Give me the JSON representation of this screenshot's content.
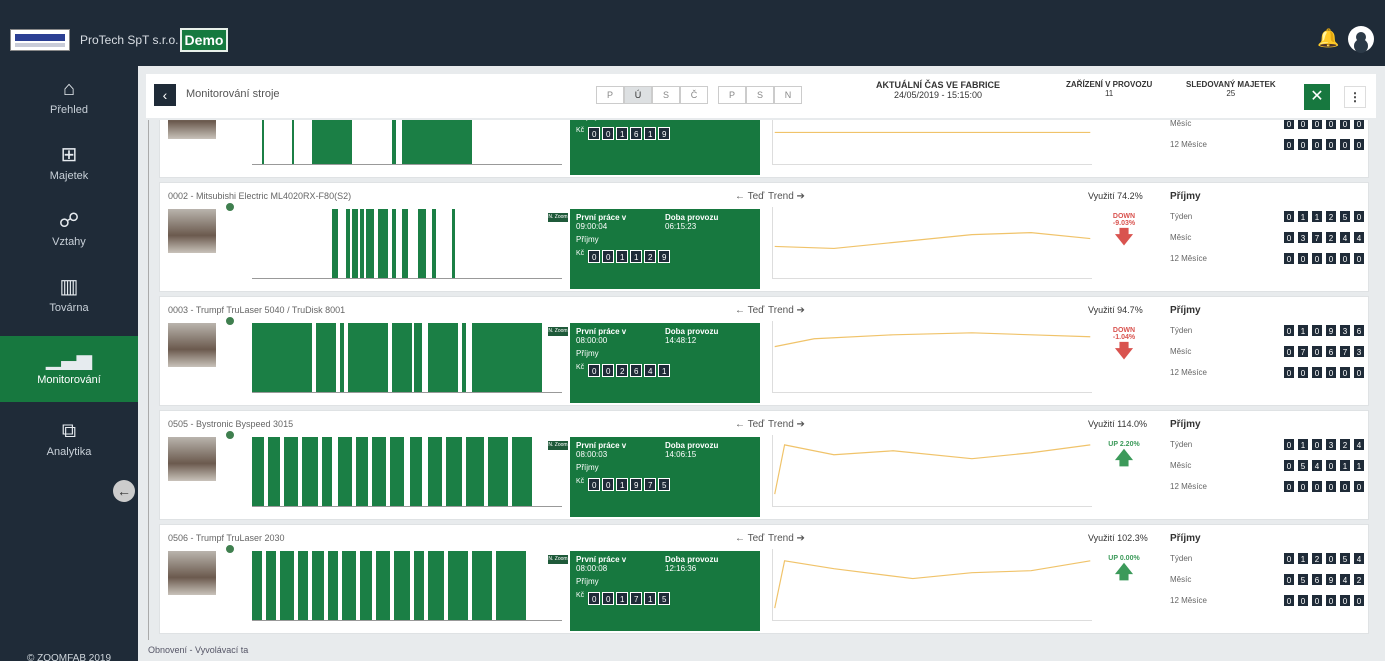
{
  "topbar": {
    "company": "ProTech SpT s.r.o.",
    "demo_label": "Demo"
  },
  "sidebar": {
    "items": [
      {
        "label": "Přehled",
        "icon": "home-icon"
      },
      {
        "label": "Majetek",
        "icon": "sitemap-icon"
      },
      {
        "label": "Vztahy",
        "icon": "users-icon"
      },
      {
        "label": "Továrna",
        "icon": "factory-icon"
      },
      {
        "label": "Monitorování",
        "icon": "bar-chart-icon"
      },
      {
        "label": "Analytika",
        "icon": "line-chart-icon"
      }
    ],
    "copyright": "© ZOOMFAB 2019"
  },
  "header": {
    "title": "Monitorování stroje",
    "shifts": [
      "P",
      "Ú",
      "S",
      "Č",
      "P",
      "S",
      "N"
    ],
    "factory_time_label": "AKTUÁLNÍ ČAS VE FABRICE",
    "factory_time": "24/05/2019 - 15:15:00",
    "devices_label": "ZAŘÍZENÍ V PROVOZU",
    "devices_count": "11",
    "tracked_label": "SLEDOVANÝ MAJETEK",
    "tracked_count": "25"
  },
  "common": {
    "ted": "← Teď",
    "trend": "Trend ➔",
    "revenue": "Příjmy",
    "week": "Týden",
    "month": "Měsíc",
    "year": "12 Měsíce",
    "first_work": "První práce v",
    "duration": "Doba provozu",
    "income": "Příjmy",
    "small_btn": "N. Zoom",
    "currency": "Kč"
  },
  "rows": [
    {
      "title": "",
      "first_work": "",
      "duration": "",
      "counter": [
        "0",
        "0",
        "1",
        "6",
        "1",
        "9"
      ],
      "util": "",
      "trend_dir": "down",
      "trend_text": "",
      "week": [
        "0",
        "0",
        "0",
        "0",
        "0",
        "0"
      ],
      "month": [
        "0",
        "0",
        "0",
        "0",
        "0",
        "0"
      ],
      "year": [
        "0",
        "0",
        "0",
        "0",
        "0",
        "0"
      ]
    },
    {
      "title": "0002 - Mitsubishi Electric ML4020RX-F80(S2)",
      "first_work": "09:00:04",
      "duration": "06:15:23",
      "counter": [
        "0",
        "0",
        "1",
        "1",
        "2",
        "9"
      ],
      "util": "Využití 74.2%",
      "trend_dir": "down",
      "trend_text": "DOWN -9.03%",
      "week": [
        "0",
        "1",
        "1",
        "2",
        "5",
        "0"
      ],
      "month": [
        "0",
        "3",
        "7",
        "2",
        "4",
        "4"
      ],
      "year": [
        "0",
        "0",
        "0",
        "0",
        "0",
        "0"
      ]
    },
    {
      "title": "0003 - Trumpf TruLaser 5040 / TruDisk 8001",
      "first_work": "08:00:00",
      "duration": "14:48:12",
      "counter": [
        "0",
        "0",
        "2",
        "6",
        "4",
        "1"
      ],
      "util": "Využití 94.7%",
      "trend_dir": "down",
      "trend_text": "DOWN -1.04%",
      "week": [
        "0",
        "1",
        "0",
        "9",
        "3",
        "6"
      ],
      "month": [
        "0",
        "7",
        "0",
        "6",
        "7",
        "3"
      ],
      "year": [
        "0",
        "0",
        "0",
        "0",
        "0",
        "0"
      ]
    },
    {
      "title": "0505 - Bystronic Byspeed 3015",
      "first_work": "08:00:03",
      "duration": "14:06:15",
      "counter": [
        "0",
        "0",
        "1",
        "9",
        "7",
        "5"
      ],
      "util": "Využití 114.0%",
      "trend_dir": "up",
      "trend_text": "UP 2.20%",
      "week": [
        "0",
        "1",
        "0",
        "3",
        "2",
        "4"
      ],
      "month": [
        "0",
        "5",
        "4",
        "0",
        "1",
        "1"
      ],
      "year": [
        "0",
        "0",
        "0",
        "0",
        "0",
        "0"
      ]
    },
    {
      "title": "0506 - Trumpf TruLaser 2030",
      "first_work": "08:00:08",
      "duration": "12:16:36",
      "counter": [
        "0",
        "0",
        "1",
        "7",
        "1",
        "5"
      ],
      "util": "Využití 102.3%",
      "trend_dir": "up",
      "trend_text": "UP 0.00%",
      "week": [
        "0",
        "1",
        "2",
        "0",
        "5",
        "4"
      ],
      "month": [
        "0",
        "5",
        "6",
        "9",
        "4",
        "2"
      ],
      "year": [
        "0",
        "0",
        "0",
        "0",
        "0",
        "0"
      ]
    }
  ],
  "footer_link": "Obnovení - Vyvolávací ta"
}
